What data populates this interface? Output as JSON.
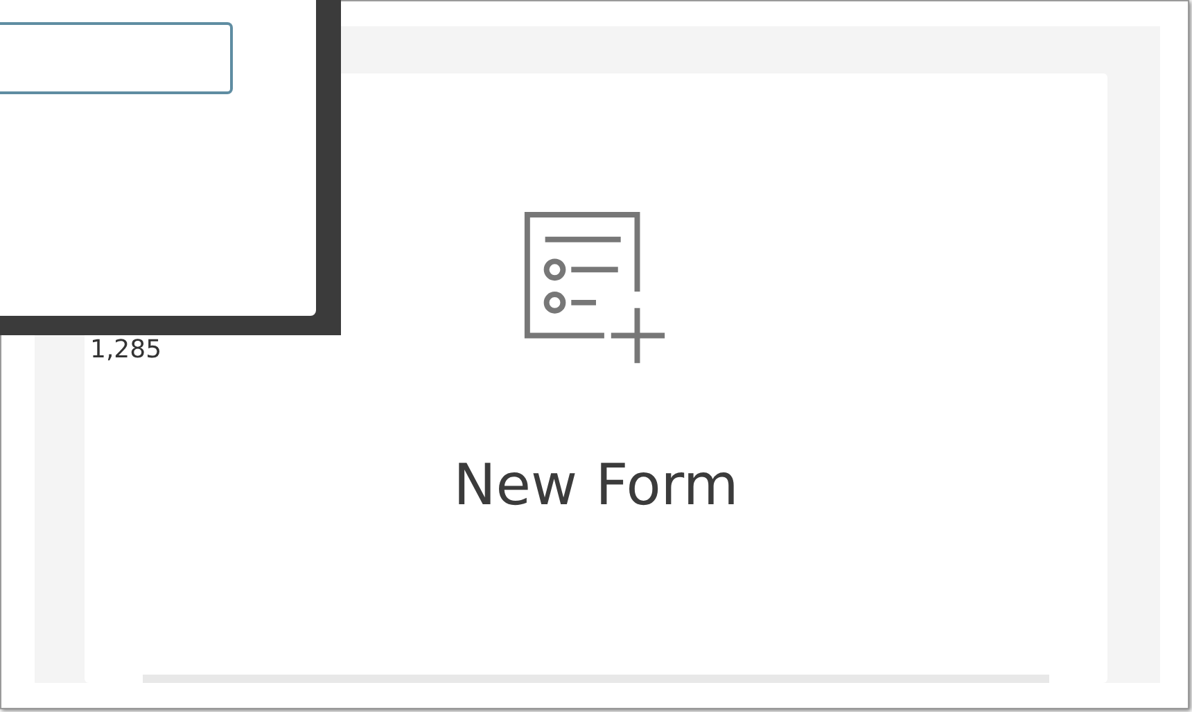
{
  "background_value": "1,285",
  "tile": {
    "label": "New Form"
  }
}
